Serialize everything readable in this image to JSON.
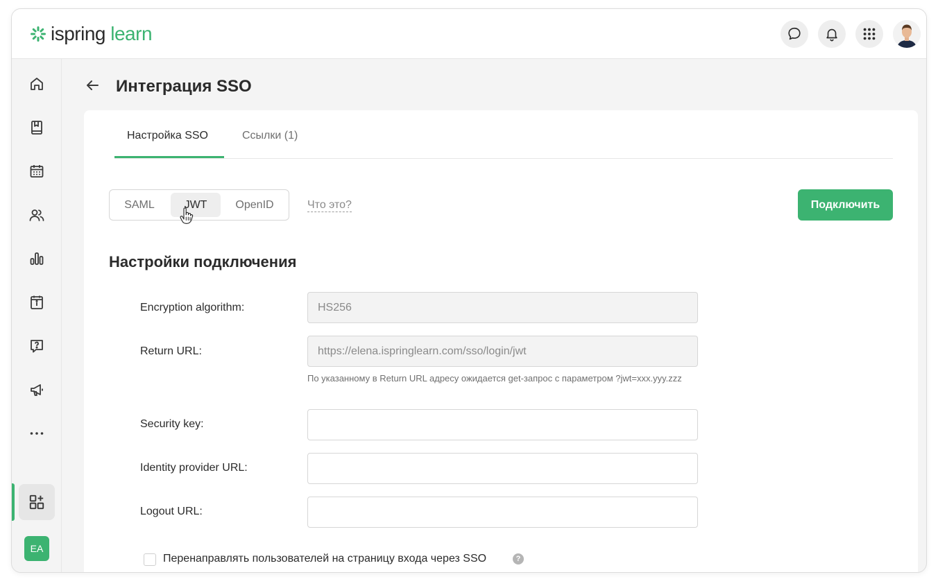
{
  "logo": {
    "part1": "ispring",
    "part2": "learn"
  },
  "topbar": {
    "icons": [
      "chat-icon",
      "bell-icon",
      "apps-grid-icon",
      "user-avatar"
    ]
  },
  "sidebar": {
    "items": [
      "home-icon",
      "library-icon",
      "calendar-icon",
      "users-icon",
      "reports-icon",
      "info-icon",
      "help-icon",
      "megaphone-icon",
      "more-icon",
      "integrations-icon"
    ],
    "user_initials": "EA"
  },
  "page": {
    "title": "Интеграция SSO"
  },
  "tabs": [
    {
      "label": "Настройка SSO",
      "active": true
    },
    {
      "label": "Ссылки (1)",
      "active": false
    }
  ],
  "protocols": {
    "options": [
      "SAML",
      "JWT",
      "OpenID"
    ],
    "selected": "JWT",
    "what_is_link": "Что это?"
  },
  "connect_button": "Подключить",
  "section_title": "Настройки подключения",
  "form": {
    "encryption_label": "Encryption algorithm:",
    "encryption_value": "HS256",
    "return_url_label": "Return URL:",
    "return_url_value": "https://elena.ispringlearn.com/sso/login/jwt",
    "return_url_hint": "По указанному в Return URL адресу ожидается get-запрос с параметром ?jwt=xxx.yyy.zzz",
    "security_key_label": "Security key:",
    "security_key_value": "",
    "idp_url_label": "Identity provider URL:",
    "idp_url_value": "",
    "logout_url_label": "Logout URL:",
    "logout_url_value": "",
    "redirect_checkbox_label": "Перенаправлять пользователей на страницу входа через SSO",
    "help_glyph": "?"
  },
  "colors": {
    "accent": "#3cb371",
    "text": "#2b2b2b",
    "muted": "#6f6f6f"
  }
}
